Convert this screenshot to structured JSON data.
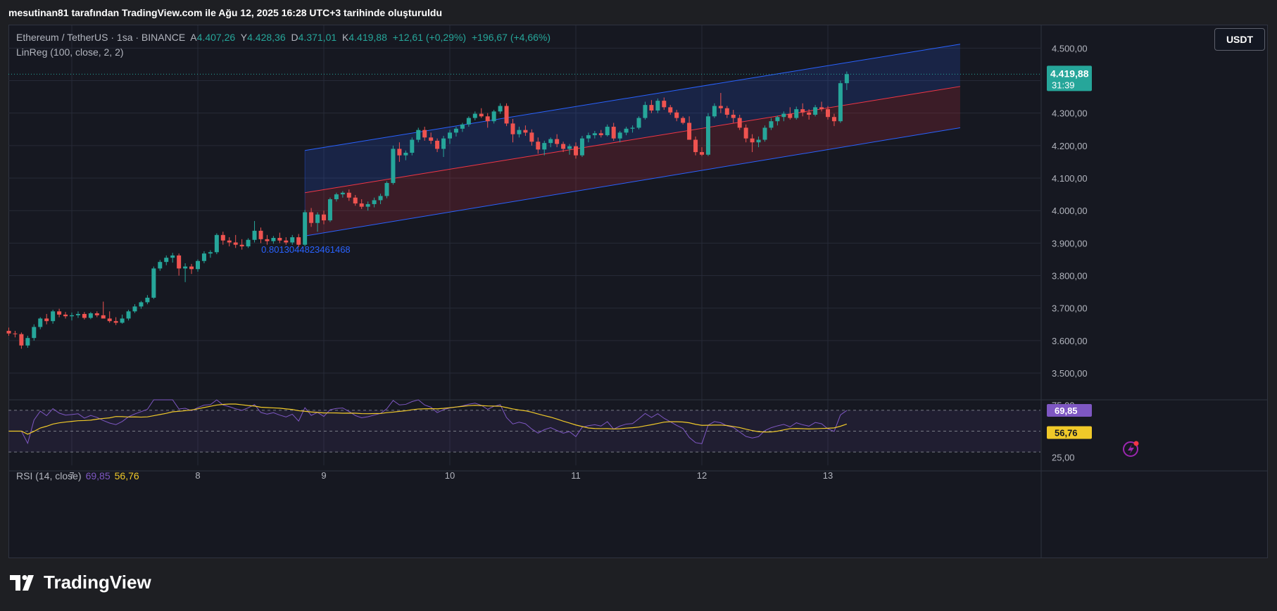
{
  "header": {
    "created_by": "mesutinan81 tarafından TradingView.com ile Ağu 12, 2025 16:28 UTC+3 tarihinde oluşturuldu"
  },
  "legend": {
    "symbol": "Ethereum / TetherUS · 1sa · BINANCE",
    "open_label": "A",
    "open": "4.407,26",
    "high_label": "Y",
    "high": "4.428,36",
    "low_label": "D",
    "low": "4.371,01",
    "close_label": "K",
    "close": "4.419,88",
    "change": "+12,61 (+0,29%)",
    "change2": "+196,67 (+4,66%)",
    "indicator": "LinReg (100, close, 2, 2)"
  },
  "rsi_legend": {
    "label": "RSI (14, close)",
    "rsi": "69,85",
    "ma": "56,76"
  },
  "currency_button": "USDT",
  "price_badge": {
    "price": "4.419,88",
    "timer": "31:39"
  },
  "regression_label": "0.8013044823461468",
  "footer": {
    "brand": "TradingView"
  },
  "colors": {
    "up": "#26a69a",
    "down": "#ef5350",
    "rsi_line": "#7e57c2",
    "rsi_ma": "#f0c929",
    "channel_upper": "#2962ff",
    "channel_mid": "#f23645"
  },
  "chart_data": {
    "type": "candlestick",
    "symbol": "Ethereum / TetherUS",
    "interval": "1sa",
    "exchange": "BINANCE",
    "ylim": [
      3420,
      4570
    ],
    "y_ticks": [
      "4.500,00",
      "4.400,00",
      "4.300,00",
      "4.200,00",
      "4.100,00",
      "4.000,00",
      "3.900,00",
      "3.800,00",
      "3.700,00",
      "3.600,00",
      "3.500,00"
    ],
    "y_tick_values": [
      4500,
      4400,
      4300,
      4200,
      4100,
      4000,
      3900,
      3800,
      3700,
      3600,
      3500
    ],
    "x_ticks": [
      "7",
      "8",
      "9",
      "10",
      "11",
      "12",
      "13"
    ],
    "x_tick_candle_index": [
      10,
      30,
      50,
      70,
      90,
      110,
      130
    ],
    "candles": [
      [
        3630,
        3640,
        3615,
        3622
      ],
      [
        3622,
        3630,
        3610,
        3620
      ],
      [
        3620,
        3625,
        3575,
        3585
      ],
      [
        3585,
        3615,
        3578,
        3608
      ],
      [
        3608,
        3650,
        3600,
        3642
      ],
      [
        3642,
        3672,
        3635,
        3668
      ],
      [
        3668,
        3682,
        3650,
        3660
      ],
      [
        3660,
        3695,
        3652,
        3690
      ],
      [
        3690,
        3698,
        3672,
        3680
      ],
      [
        3680,
        3688,
        3668,
        3675
      ],
      [
        3675,
        3686,
        3662,
        3678
      ],
      [
        3678,
        3690,
        3670,
        3682
      ],
      [
        3682,
        3688,
        3665,
        3670
      ],
      [
        3670,
        3688,
        3666,
        3684
      ],
      [
        3684,
        3690,
        3672,
        3678
      ],
      [
        3678,
        3720,
        3672,
        3668
      ],
      [
        3668,
        3690,
        3655,
        3660
      ],
      [
        3660,
        3672,
        3648,
        3655
      ],
      [
        3655,
        3680,
        3652,
        3668
      ],
      [
        3668,
        3695,
        3662,
        3690
      ],
      [
        3690,
        3712,
        3685,
        3705
      ],
      [
        3705,
        3722,
        3698,
        3718
      ],
      [
        3718,
        3740,
        3712,
        3732
      ],
      [
        3732,
        3828,
        3728,
        3822
      ],
      [
        3822,
        3848,
        3815,
        3842
      ],
      [
        3842,
        3862,
        3832,
        3855
      ],
      [
        3855,
        3870,
        3840,
        3862
      ],
      [
        3862,
        3868,
        3800,
        3822
      ],
      [
        3822,
        3838,
        3780,
        3828
      ],
      [
        3828,
        3836,
        3805,
        3820
      ],
      [
        3820,
        3850,
        3812,
        3845
      ],
      [
        3845,
        3875,
        3838,
        3868
      ],
      [
        3868,
        3878,
        3855,
        3872
      ],
      [
        3872,
        3930,
        3866,
        3925
      ],
      [
        3925,
        3935,
        3895,
        3908
      ],
      [
        3908,
        3918,
        3890,
        3902
      ],
      [
        3902,
        3925,
        3885,
        3895
      ],
      [
        3895,
        3912,
        3880,
        3890
      ],
      [
        3890,
        3915,
        3885,
        3910
      ],
      [
        3910,
        3968,
        3902,
        3938
      ],
      [
        3938,
        3948,
        3900,
        3912
      ],
      [
        3912,
        3925,
        3895,
        3906
      ],
      [
        3906,
        3922,
        3898,
        3916
      ],
      [
        3916,
        3932,
        3900,
        3908
      ],
      [
        3908,
        3918,
        3895,
        3902
      ],
      [
        3902,
        3925,
        3895,
        3918
      ],
      [
        3918,
        3928,
        3888,
        3895
      ],
      [
        3895,
        4002,
        3890,
        3995
      ],
      [
        3995,
        4008,
        3950,
        3962
      ],
      [
        3962,
        3995,
        3935,
        3988
      ],
      [
        3988,
        4000,
        3958,
        3970
      ],
      [
        3970,
        4040,
        3965,
        4035
      ],
      [
        4035,
        4055,
        4028,
        4050
      ],
      [
        4050,
        4060,
        4040,
        4055
      ],
      [
        4055,
        4065,
        4030,
        4040
      ],
      [
        4040,
        4048,
        4015,
        4022
      ],
      [
        4022,
        4035,
        4005,
        4012
      ],
      [
        4012,
        4028,
        4000,
        4020
      ],
      [
        4020,
        4040,
        4010,
        4032
      ],
      [
        4032,
        4052,
        4020,
        4045
      ],
      [
        4045,
        4090,
        4038,
        4085
      ],
      [
        4085,
        4200,
        4080,
        4190
      ],
      [
        4190,
        4210,
        4150,
        4170
      ],
      [
        4170,
        4185,
        4155,
        4178
      ],
      [
        4178,
        4225,
        4170,
        4218
      ],
      [
        4218,
        4255,
        4210,
        4248
      ],
      [
        4248,
        4258,
        4215,
        4225
      ],
      [
        4225,
        4240,
        4205,
        4215
      ],
      [
        4215,
        4222,
        4180,
        4190
      ],
      [
        4190,
        4230,
        4165,
        4222
      ],
      [
        4222,
        4248,
        4205,
        4240
      ],
      [
        4240,
        4258,
        4228,
        4252
      ],
      [
        4252,
        4270,
        4242,
        4265
      ],
      [
        4265,
        4290,
        4258,
        4285
      ],
      [
        4285,
        4305,
        4278,
        4298
      ],
      [
        4298,
        4315,
        4285,
        4290
      ],
      [
        4290,
        4300,
        4255,
        4275
      ],
      [
        4275,
        4310,
        4268,
        4305
      ],
      [
        4305,
        4330,
        4298,
        4322
      ],
      [
        4322,
        4330,
        4260,
        4268
      ],
      [
        4268,
        4282,
        4210,
        4235
      ],
      [
        4235,
        4258,
        4225,
        4248
      ],
      [
        4248,
        4262,
        4230,
        4240
      ],
      [
        4240,
        4250,
        4200,
        4212
      ],
      [
        4212,
        4225,
        4175,
        4188
      ],
      [
        4188,
        4215,
        4170,
        4208
      ],
      [
        4208,
        4225,
        4195,
        4220
      ],
      [
        4220,
        4235,
        4195,
        4205
      ],
      [
        4205,
        4212,
        4180,
        4190
      ],
      [
        4190,
        4205,
        4172,
        4198
      ],
      [
        4198,
        4210,
        4160,
        4170
      ],
      [
        4170,
        4230,
        4165,
        4222
      ],
      [
        4222,
        4240,
        4210,
        4232
      ],
      [
        4232,
        4245,
        4222,
        4238
      ],
      [
        4238,
        4248,
        4225,
        4232
      ],
      [
        4232,
        4265,
        4228,
        4258
      ],
      [
        4258,
        4270,
        4215,
        4222
      ],
      [
        4222,
        4245,
        4210,
        4240
      ],
      [
        4240,
        4258,
        4232,
        4252
      ],
      [
        4252,
        4262,
        4240,
        4255
      ],
      [
        4255,
        4290,
        4250,
        4285
      ],
      [
        4285,
        4335,
        4280,
        4325
      ],
      [
        4325,
        4340,
        4300,
        4308
      ],
      [
        4308,
        4345,
        4300,
        4338
      ],
      [
        4338,
        4348,
        4310,
        4318
      ],
      [
        4318,
        4325,
        4295,
        4302
      ],
      [
        4302,
        4310,
        4275,
        4285
      ],
      [
        4285,
        4290,
        4265,
        4270
      ],
      [
        4270,
        4290,
        4240,
        4218
      ],
      [
        4218,
        4228,
        4170,
        4180
      ],
      [
        4180,
        4195,
        4168,
        4172
      ],
      [
        4172,
        4300,
        4168,
        4290
      ],
      [
        4290,
        4330,
        4285,
        4322
      ],
      [
        4322,
        4362,
        4300,
        4315
      ],
      [
        4315,
        4322,
        4285,
        4295
      ],
      [
        4295,
        4310,
        4270,
        4285
      ],
      [
        4285,
        4295,
        4248,
        4255
      ],
      [
        4255,
        4265,
        4210,
        4222
      ],
      [
        4222,
        4235,
        4180,
        4210
      ],
      [
        4210,
        4228,
        4195,
        4218
      ],
      [
        4218,
        4262,
        4212,
        4255
      ],
      [
        4255,
        4285,
        4248,
        4275
      ],
      [
        4275,
        4292,
        4262,
        4288
      ],
      [
        4288,
        4305,
        4275,
        4298
      ],
      [
        4298,
        4318,
        4280,
        4285
      ],
      [
        4285,
        4320,
        4280,
        4312
      ],
      [
        4312,
        4330,
        4290,
        4302
      ],
      [
        4302,
        4312,
        4280,
        4295
      ],
      [
        4295,
        4325,
        4290,
        4318
      ],
      [
        4318,
        4335,
        4305,
        4312
      ],
      [
        4312,
        4322,
        4280,
        4288
      ],
      [
        4288,
        4298,
        4260,
        4275
      ],
      [
        4275,
        4400,
        4270,
        4392
      ],
      [
        4392,
        4428,
        4371,
        4419.88
      ]
    ],
    "linreg": {
      "start_index": 47,
      "end_index": 151,
      "upper": [
        4185,
        4512
      ],
      "middle": [
        4055,
        4382
      ],
      "lower": [
        3922,
        4255
      ]
    },
    "current_price": 4419.88,
    "rsi": {
      "ylim": [
        20,
        80
      ],
      "levels": [
        70,
        50,
        30
      ],
      "y_ticks": [
        "75,00",
        "50,00",
        "25,00"
      ],
      "y_tick_values": [
        75,
        50,
        25
      ],
      "last_rsi": 69.85,
      "last_ma": 56.76
    }
  }
}
